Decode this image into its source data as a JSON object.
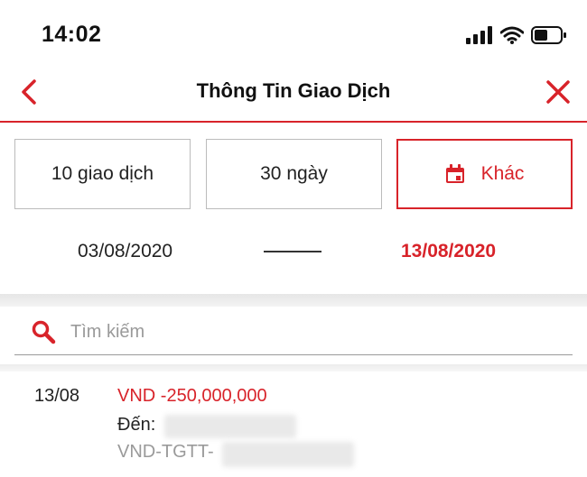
{
  "status_bar": {
    "time": "14:02",
    "icons": [
      "signal-icon",
      "wifi-icon",
      "battery-icon"
    ]
  },
  "nav": {
    "title": "Thông Tin Giao Dịch",
    "back_icon": "chevron-left-icon",
    "close_icon": "close-icon"
  },
  "filters": [
    {
      "label": "10 giao dịch",
      "selected": false
    },
    {
      "label": "30 ngày",
      "selected": false
    },
    {
      "label": "Khác",
      "selected": true,
      "icon": "calendar-icon"
    }
  ],
  "date_range": {
    "from": "03/08/2020",
    "to": "13/08/2020"
  },
  "search": {
    "placeholder": "Tìm kiếm",
    "value": ""
  },
  "transactions": [
    {
      "date": "13/08",
      "amount": "VND -250,000,000",
      "to_label": "Đến:",
      "ref": "VND-TGTT-"
    }
  ],
  "colors": {
    "accent": "#d8232a",
    "muted_text": "#9a9a9a",
    "border": "#bbbbbb"
  }
}
